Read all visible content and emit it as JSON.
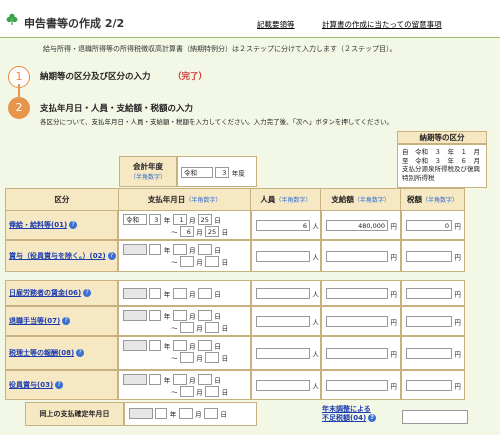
{
  "header": {
    "title": "申告書等の作成 2/2",
    "link1": "記載要領等",
    "link2": "計算書の作成に当たっての留意事項"
  },
  "intro": "給与所得・退職所得等の所得税徴収高計算書（納期特例分）は２ステップに分けて入力します（２ステップ目）。",
  "steps": [
    {
      "num": "1",
      "label": "納期等の区分及び区分の入力",
      "status": "（完了）"
    },
    {
      "num": "2",
      "label": "支払年月日・人員・支給額・税額の入力",
      "desc": "各区分について、支払年月日・人員・支給額・税額を入力してください。入力完了後、「次へ」ボタンを押してください。"
    }
  ],
  "fiscal": {
    "label": "会計年度",
    "hint": "（半角数字）",
    "era": "令和",
    "year": "3",
    "unit": "年度"
  },
  "noki": {
    "title": "納期等の区分",
    "from_label": "自",
    "to_label": "至",
    "from": "令和　３　年　１　月",
    "to": "令和　３　年　６　月",
    "note": "支払分源泉所得税及び復興特別所得税"
  },
  "columns": {
    "kubun": "区分",
    "date": "支払年月日",
    "date_hint": "（半角数字）",
    "people": "人員",
    "people_hint": "（半角数字）",
    "amount": "支給額",
    "amount_hint": "（半角数字）",
    "tax": "税額",
    "tax_hint": "（半角数字）"
  },
  "units": {
    "year": "年",
    "month": "月",
    "day": "日",
    "tilde": "〜",
    "person": "人",
    "yen": "円"
  },
  "rows": [
    {
      "label": "俸給・給料等(01)",
      "era": "令和",
      "y1": "3",
      "m1": "1",
      "d1": "25",
      "m2": "6",
      "d2": "25",
      "people": "6",
      "amount": "480,000",
      "tax": "0"
    },
    {
      "label": "賞与（役員賞与を除く。）(02)",
      "era": "",
      "y1": "",
      "m1": "",
      "d1": "",
      "m2": "",
      "d2": "",
      "people": "",
      "amount": "",
      "tax": ""
    },
    {
      "label": "日雇労務者の賃金(06)",
      "era": "",
      "y1": "",
      "m1": "",
      "d1": "",
      "m2": "",
      "d2": "",
      "people": "",
      "amount": "",
      "tax": ""
    },
    {
      "label": "退職手当等(07)",
      "era": "",
      "y1": "",
      "m1": "",
      "d1": "",
      "m2": "",
      "d2": "",
      "people": "",
      "amount": "",
      "tax": ""
    },
    {
      "label": "税理士等の報酬(08)",
      "era": "",
      "y1": "",
      "m1": "",
      "d1": "",
      "m2": "",
      "d2": "",
      "people": "",
      "amount": "",
      "tax": ""
    },
    {
      "label": "役員賞与(03)",
      "era": "",
      "y1": "",
      "m1": "",
      "d1": "",
      "m2": "",
      "d2": "",
      "people": "",
      "amount": "",
      "tax": ""
    }
  ],
  "bottom": {
    "label": "同上の支払確定年月日",
    "adj1": "年末調整による",
    "adj2": "不足税額(04)",
    "q": "?"
  },
  "q": "?"
}
